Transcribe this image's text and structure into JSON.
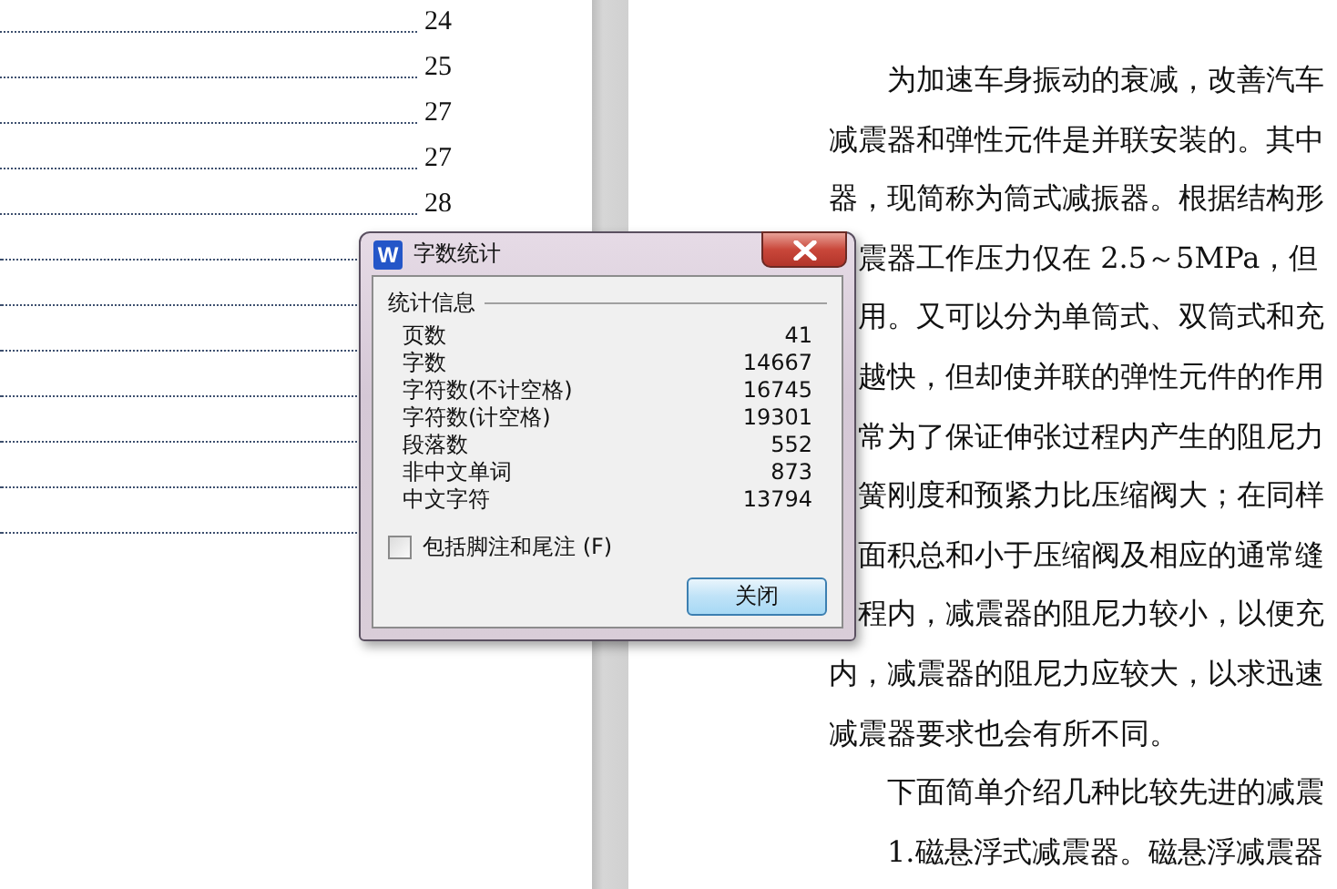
{
  "toc": {
    "entries": [
      {
        "page": "24"
      },
      {
        "page": "25"
      },
      {
        "page": "27"
      },
      {
        "page": "27"
      },
      {
        "page": "28"
      }
    ]
  },
  "document": {
    "paragraphs": [
      {
        "lines": [
          "为加速车身振动的衰减，改善汽车",
          "减震器和弹性元件是并联安装的。其中",
          "器，现简称为筒式减振器。根据结构形",
          "震器工作压力仅在 2.5～5MPa，但",
          "用。又可以分为单筒式、双筒式和充",
          "越快，但却使并联的弹性元件的作用",
          "常为了保证伸张过程内产生的阻尼力",
          "簧刚度和预紧力比压缩阀大；在同样",
          "面积总和小于压缩阀及相应的通常缝",
          "程内，减震器的阻尼力较小，以便充",
          "内，减震器的阻尼力应较大，以求迅速",
          "减震器要求也会有所不同。"
        ]
      },
      {
        "lines": [
          "下面简单介绍几种比较先进的减震"
        ]
      },
      {
        "lines": [
          "1.磁悬浮式减震器。磁悬浮减震器"
        ]
      }
    ]
  },
  "dialog": {
    "logo_letter": "W",
    "title": "字数统计",
    "group": "统计信息",
    "stats": [
      {
        "label": "页数",
        "value": "41"
      },
      {
        "label": "字数",
        "value": "14667"
      },
      {
        "label": "字符数(不计空格)",
        "value": "16745"
      },
      {
        "label": "字符数(计空格)",
        "value": "19301"
      },
      {
        "label": "段落数",
        "value": "552"
      },
      {
        "label": "非中文单词",
        "value": "873"
      },
      {
        "label": "中文字符",
        "value": "13794"
      }
    ],
    "checkbox": {
      "label": "包括脚注和尾注 (F)",
      "checked": false
    },
    "button": "关闭"
  }
}
